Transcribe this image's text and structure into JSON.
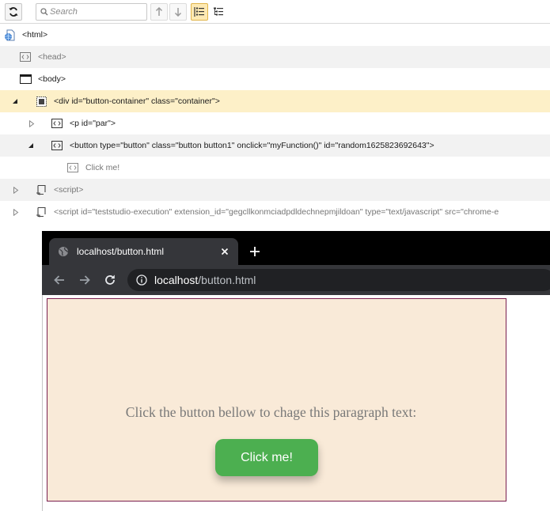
{
  "toolbar": {
    "refresh_icon": "refresh-icon",
    "search_placeholder": "Search",
    "up_icon": "arrow-up-icon",
    "down_icon": "arrow-down-icon",
    "view_icons": [
      "list-view-icon",
      "tree-view-icon"
    ],
    "active_color": "#fde9b3"
  },
  "tree": {
    "rows": [
      {
        "label": "<html>",
        "icon": "globe-document-icon"
      },
      {
        "label": "<head>",
        "icon": "element-icon"
      },
      {
        "label": "<body>",
        "icon": "window-icon"
      },
      {
        "label": "<div id=\"button-container\" class=\"container\">",
        "icon": "div-element-icon",
        "expanded": true,
        "selected": true
      },
      {
        "label": "<p id=\"par\">",
        "icon": "element-icon",
        "expanded": false
      },
      {
        "label": "<button type=\"button\" class=\"button button1\" onclick=\"myFunction()\" id=\"random1625823692643\">",
        "icon": "element-icon",
        "expanded": true
      },
      {
        "label": "Click me!",
        "icon": "text-node-icon"
      },
      {
        "label": "<script>",
        "icon": "script-icon",
        "expanded": false
      },
      {
        "label": "<script id=\"teststudio-execution\" extension_id=\"gegcllkonmciadpdldechnepmjildoan\" type=\"text/javascript\" src=\"chrome-e",
        "icon": "script-icon",
        "expanded": false
      }
    ],
    "selected_color": "#fdf0c8"
  },
  "browser": {
    "tab_title": "localhost/button.html",
    "url_host": "localhost",
    "url_path": "/button.html",
    "page": {
      "paragraph": "Click the button bellow to chage this paragraph text:",
      "button_label": "Click me!",
      "container_bg": "#f9ead8",
      "container_border": "#7a1f4f",
      "button_color": "#4caf50"
    }
  }
}
